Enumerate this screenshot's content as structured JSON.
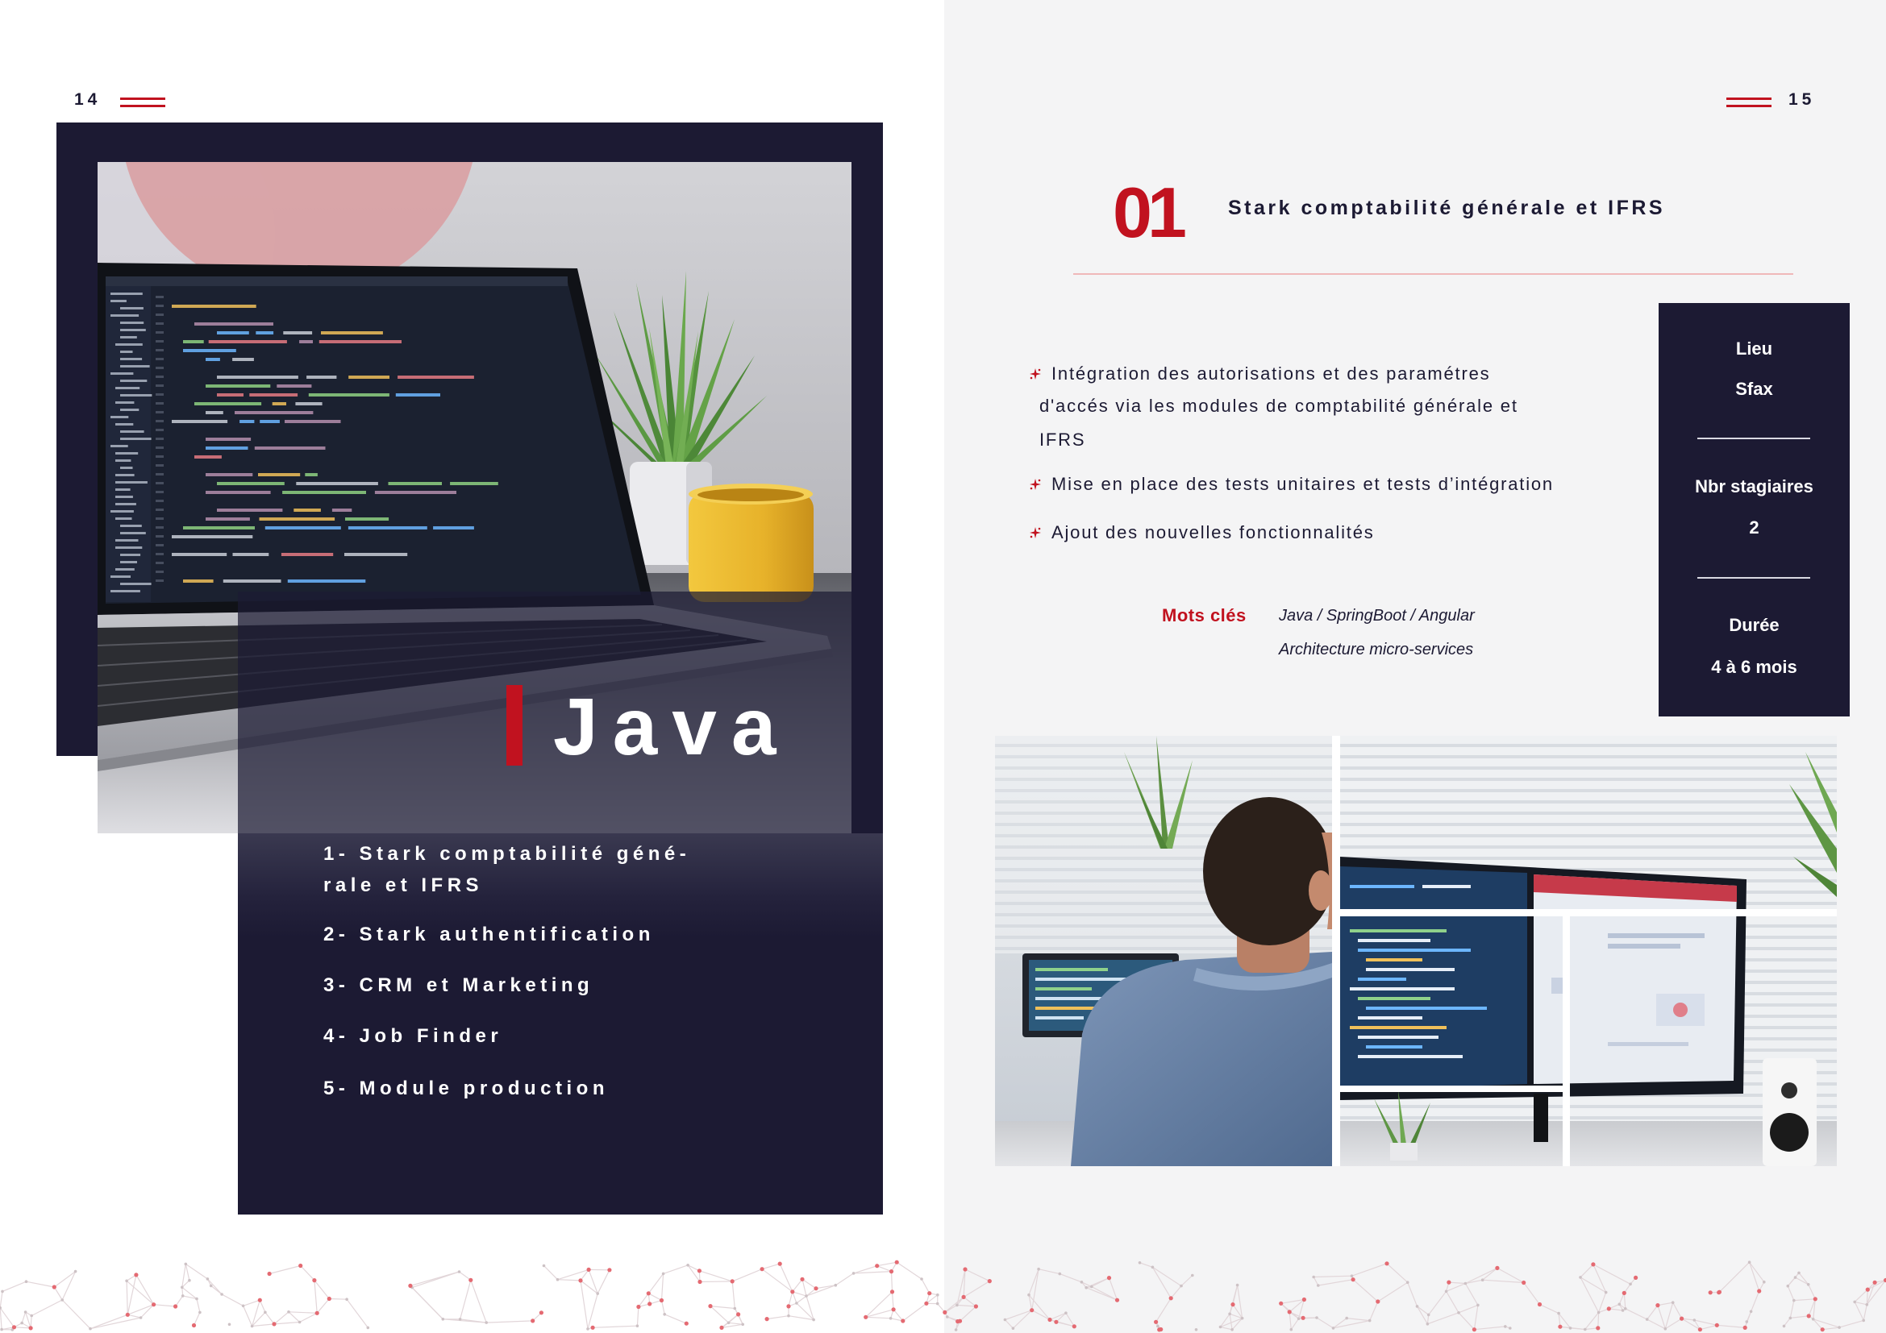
{
  "left_page": {
    "page_number": "14",
    "hero_title": "Java",
    "projects": [
      {
        "lines": [
          "1- Stark comptabilité géné-",
          "rale et IFRS"
        ]
      },
      {
        "lines": [
          "2- Stark authentification"
        ]
      },
      {
        "lines": [
          "3- CRM et Marketing"
        ]
      },
      {
        "lines": [
          "4- Job Finder"
        ]
      },
      {
        "lines": [
          "5- Module production"
        ]
      }
    ]
  },
  "right_page": {
    "page_number": "15",
    "project_number": "01",
    "project_title": "Stark comptabilité générale et IFRS",
    "tasks": [
      {
        "lines": [
          "Intégration des autorisations et des paramétres",
          "d'accés via les modules de comptabilité générale et",
          "IFRS"
        ]
      },
      {
        "lines": [
          "Mise en place des tests unitaires et tests d’intégration"
        ]
      },
      {
        "lines": [
          "Ajout des nouvelles fonctionnalités"
        ]
      }
    ],
    "keywords_label": "Mots clés",
    "keywords": [
      "Java / SpringBoot / Angular",
      "Architecture micro-services"
    ],
    "info": {
      "location_label": "Lieu",
      "location_value": "Sfax",
      "interns_label": "Nbr stagiaires",
      "interns_value": "2",
      "duration_label": "Durée",
      "duration_value": "4 à 6 mois"
    }
  },
  "colors": {
    "accent": "#c1121f",
    "navy": "#1c1a33",
    "right_page_background": "#f4f4f5",
    "divider": "#efb8b9"
  },
  "icons": {
    "task_bullet": "star-bullet-icon",
    "page_number_decoration": "double-line-icon"
  }
}
